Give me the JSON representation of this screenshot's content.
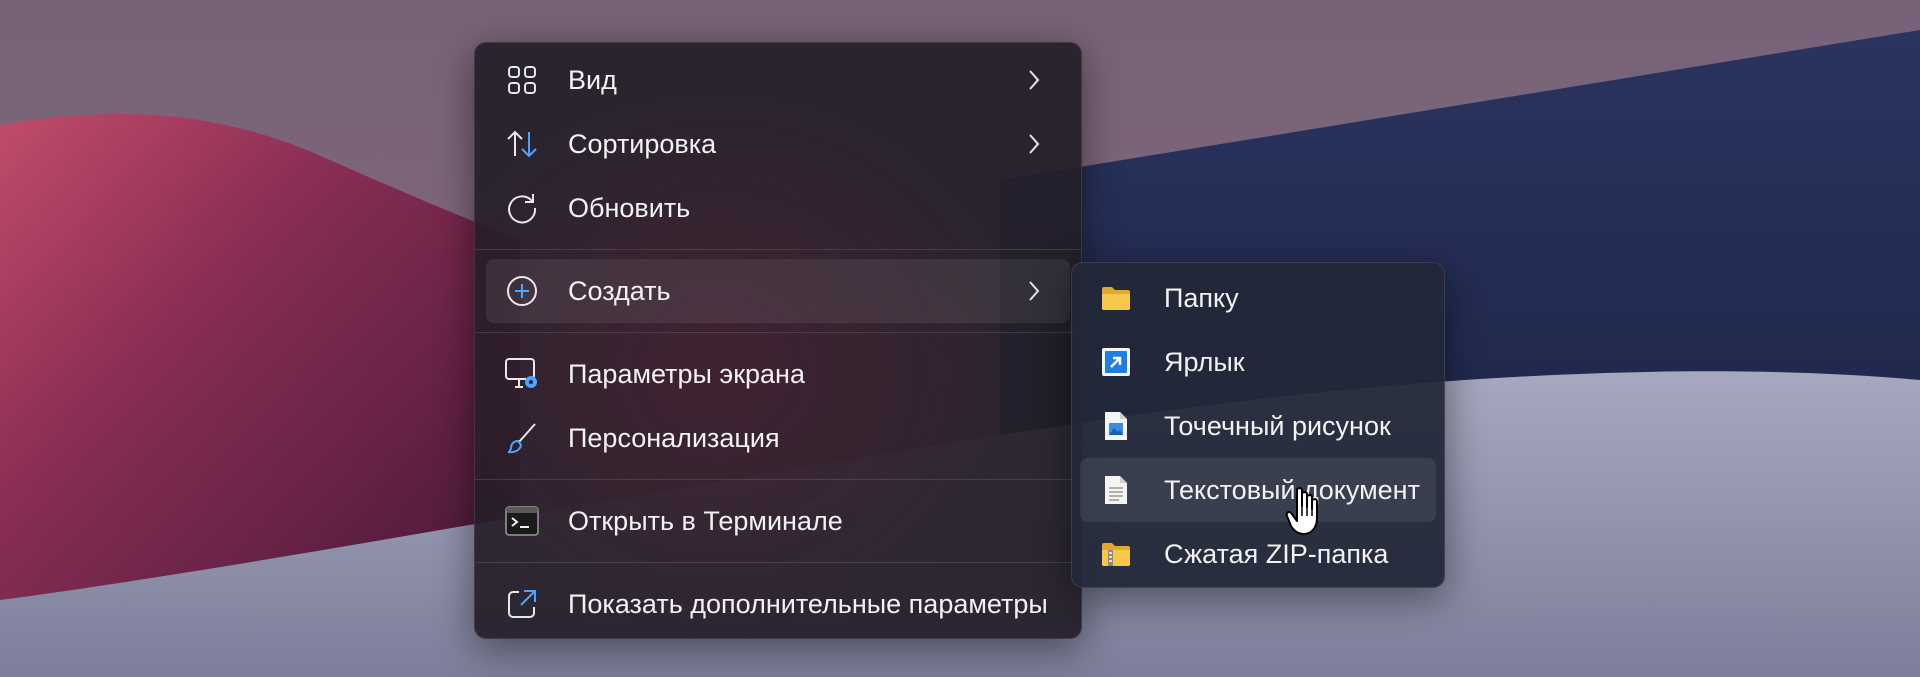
{
  "colors": {
    "menu_bg": "#26202a",
    "submenu_bg": "#222838",
    "text": "#f2f2f2",
    "accent_blue": "#4fa3ff",
    "folder_yellow": "#f7c948"
  },
  "context_menu": {
    "items": [
      {
        "label": "Вид",
        "icon": "grid-view-icon",
        "has_submenu": true
      },
      {
        "label": "Сортировка",
        "icon": "sort-arrows-icon",
        "has_submenu": true
      },
      {
        "label": "Обновить",
        "icon": "refresh-icon",
        "has_submenu": false
      },
      {
        "label": "Создать",
        "icon": "plus-circle-icon",
        "has_submenu": true,
        "highlighted": true
      },
      {
        "label": "Параметры экрана",
        "icon": "display-settings-icon",
        "has_submenu": false
      },
      {
        "label": "Персонализация",
        "icon": "paintbrush-icon",
        "has_submenu": false
      },
      {
        "label": "Открыть в Терминале",
        "icon": "terminal-icon",
        "has_submenu": false
      },
      {
        "label": "Показать дополнительные параметры",
        "icon": "expand-external-icon",
        "has_submenu": false
      }
    ]
  },
  "submenu_create": {
    "items": [
      {
        "label": "Папку",
        "icon": "folder-icon"
      },
      {
        "label": "Ярлык",
        "icon": "shortcut-icon"
      },
      {
        "label": "Точечный рисунок",
        "icon": "bitmap-image-icon"
      },
      {
        "label": "Текстовый документ",
        "icon": "text-document-icon",
        "hovered": true
      },
      {
        "label": "Сжатая ZIP-папка",
        "icon": "zip-folder-icon"
      }
    ]
  },
  "cursor": {
    "icon": "hand-pointer-icon"
  }
}
